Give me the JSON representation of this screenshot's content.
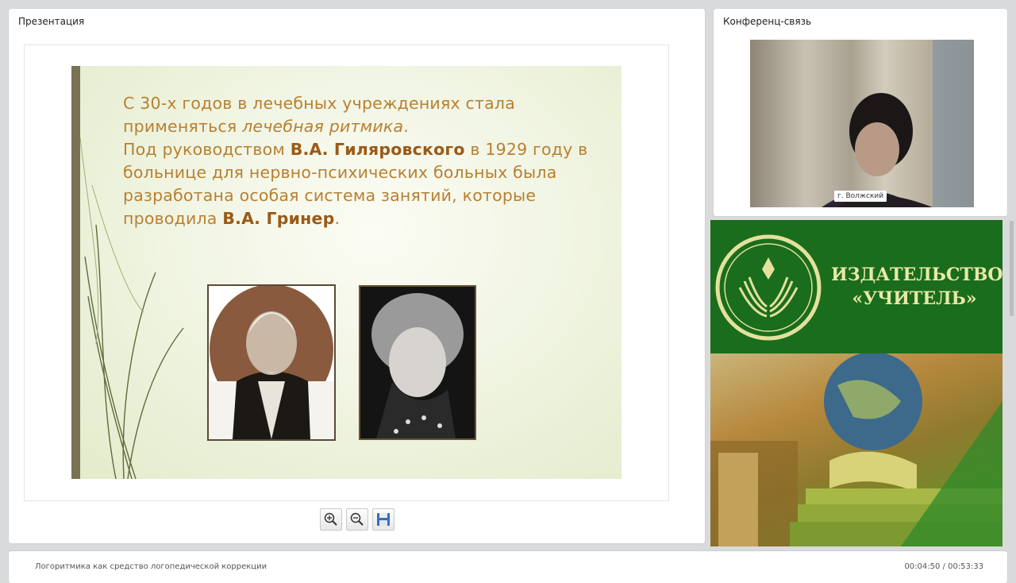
{
  "presentation": {
    "title": "Презентация",
    "slide": {
      "line1": "С 30-х годов в лечебных учреждениях стала",
      "line2_a": "применяться ",
      "line2_b": "лечебная ритмика",
      "line2_c": ".",
      "line3_a": "Под руководством ",
      "line3_b": "В.А. Гиляровского",
      "line3_c": " в 1929 году в",
      "line4": "больнице для нервно-психических больных была",
      "line5": "разработана особая система занятий, которые",
      "line6_a": "проводила ",
      "line6_b": "В.А. Гринер",
      "line6_c": "."
    },
    "toolbar": {
      "zoom_in_icon": "zoom-in-icon",
      "zoom_out_icon": "zoom-out-icon",
      "save_icon": "floppy-disk-icon"
    }
  },
  "conference": {
    "title": "Конференц-связь",
    "caption": "г. Волжский"
  },
  "banner": {
    "publisher_line1": "ИЗДАТЕЛЬСТВО",
    "publisher_line2": "«УЧИТЕЛЬ»"
  },
  "footer": {
    "course_title": "Логоритмика как средство логопедической коррекции",
    "timecode": "00:04:50 / 00:53:33"
  },
  "colors": {
    "slide_text": "#b88032",
    "slide_bold": "#9a5a16",
    "banner_green": "#1a6d1c",
    "publisher_text": "#e9e8a8"
  }
}
